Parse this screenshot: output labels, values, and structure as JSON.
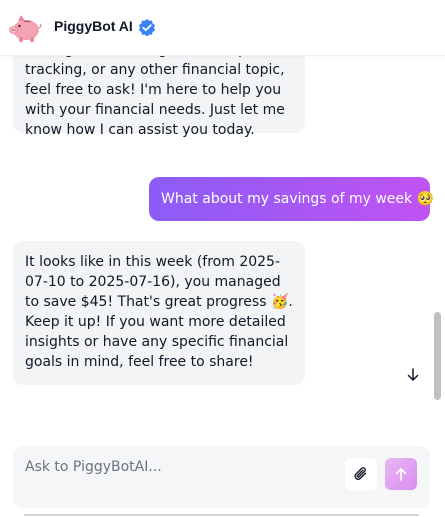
{
  "header": {
    "bot_name": "PiggyBot AI",
    "logo_icon": "piggy-bank-icon",
    "verified_icon": "verified-badge-icon"
  },
  "messages": [
    {
      "role": "assistant",
      "text": "setting, debt management, expense tracking, or any other financial topic, feel free to ask! I'm here to help you with your financial needs. Just let me know how I can assist you today."
    },
    {
      "role": "user",
      "text": "What about my savings of my week 🥺"
    },
    {
      "role": "assistant",
      "text": "It looks like in this week (from 2025-07-10 to 2025-07-16), you managed to save $45! That's great progress 🥳. Keep it up! If you want more detailed insights or have any specific financial goals in mind, feel free to share!"
    }
  ],
  "composer": {
    "placeholder": "Ask to PiggyBotAI...",
    "value": "",
    "attach_icon": "paperclip-icon",
    "send_icon": "arrow-up-icon"
  },
  "scroll": {
    "down_icon": "arrow-down-icon"
  },
  "colors": {
    "user_bubble_start": "#8b5cf6",
    "user_bubble_end": "#c053f3",
    "bot_bubble": "#f3f4f6",
    "verified": "#3b82f6",
    "send_button": "#e0a3f2"
  }
}
